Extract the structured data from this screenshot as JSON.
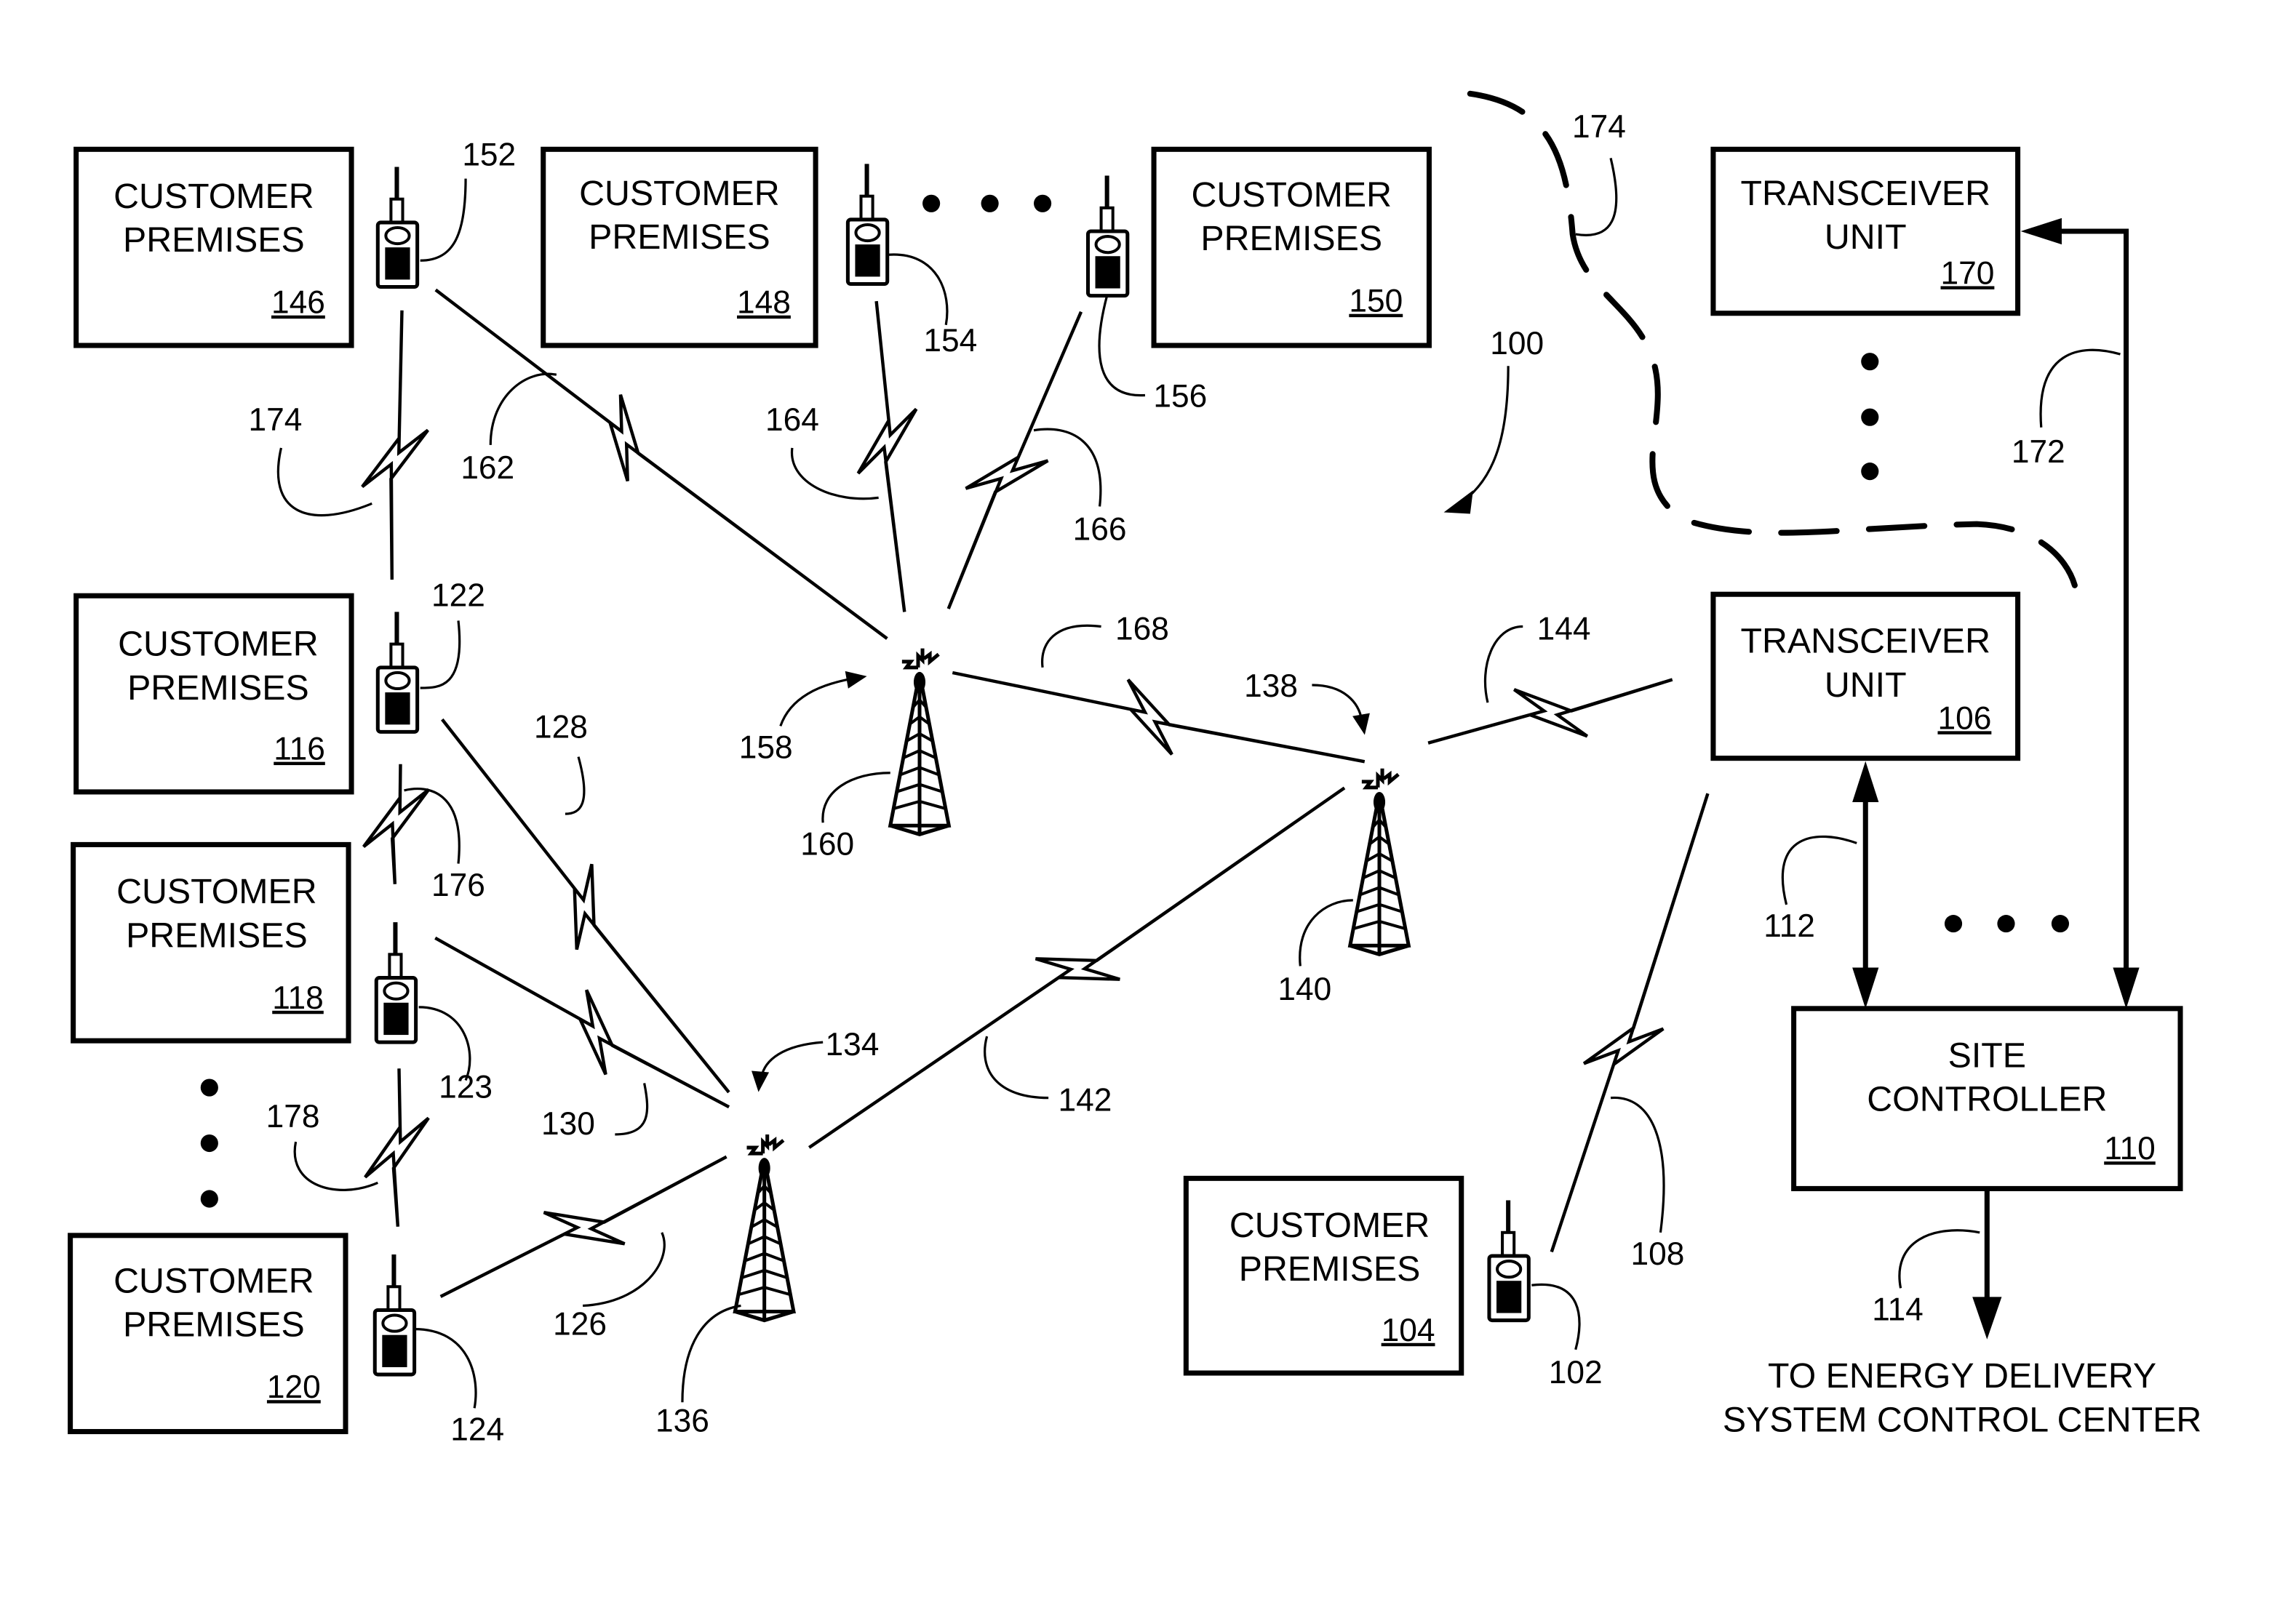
{
  "figure": {
    "system_ref": "100",
    "customer_premises_label": [
      "CUSTOMER",
      "PREMISES"
    ],
    "transceiver_label": [
      "TRANSCEIVER",
      "UNIT"
    ],
    "site_controller_label": [
      "SITE",
      "CONTROLLER"
    ],
    "output_caption": [
      "TO  ENERGY  DELIVERY",
      "SYSTEM  CONTROL  CENTER"
    ],
    "premises": [
      {
        "ref": "146",
        "device_ref": "152"
      },
      {
        "ref": "148",
        "device_ref": "154"
      },
      {
        "ref": "150",
        "device_ref": "156"
      },
      {
        "ref": "116",
        "device_ref": "122"
      },
      {
        "ref": "118",
        "device_ref": "123"
      },
      {
        "ref": "120",
        "device_ref": "124"
      },
      {
        "ref": "104",
        "device_ref": "102"
      }
    ],
    "transceivers": [
      {
        "ref": "170"
      },
      {
        "ref": "106"
      }
    ],
    "site_controller": {
      "ref": "110"
    },
    "repeaters": [
      {
        "ref": "160",
        "pointer_ref": "158"
      },
      {
        "ref": "140",
        "pointer_ref": "138"
      },
      {
        "ref": "136",
        "pointer_ref": "134"
      }
    ],
    "links": {
      "l174a": "174",
      "l162": "162",
      "l164": "164",
      "l166": "166",
      "l168": "168",
      "l144": "144",
      "l128": "128",
      "l176": "176",
      "l130": "130",
      "l142": "142",
      "l178": "178",
      "l126": "126",
      "l108": "108",
      "l112": "112",
      "l172": "172",
      "l114": "114",
      "l174b": "174"
    }
  }
}
